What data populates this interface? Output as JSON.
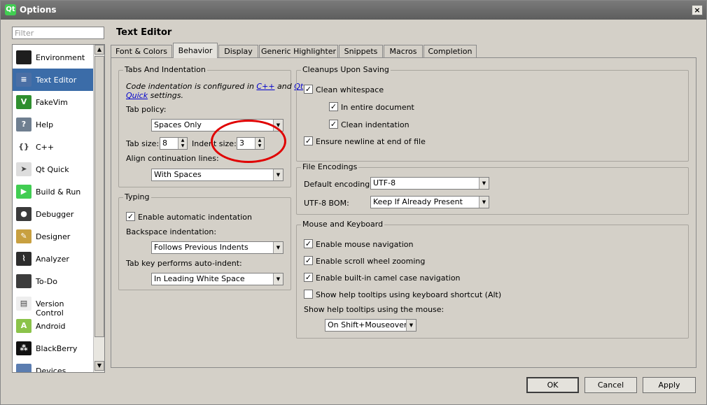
{
  "window": {
    "title": "Options",
    "app_icon": "qt-icon",
    "close_label": "×"
  },
  "filter": {
    "placeholder": "Filter"
  },
  "sidebar": {
    "items": [
      {
        "label": "Environment",
        "icon": "monitor-icon",
        "icon_color": "#1e1e1e",
        "glyph": ""
      },
      {
        "label": "Text Editor",
        "icon": "text-editor-icon",
        "icon_color": "#4a6fa5",
        "glyph": "≡",
        "selected": true
      },
      {
        "label": "FakeVim",
        "icon": "fakevim-icon",
        "icon_color": "#2f8f2f",
        "glyph": "V"
      },
      {
        "label": "Help",
        "icon": "help-icon",
        "icon_color": "#6f7f90",
        "glyph": "?"
      },
      {
        "label": "C++",
        "icon": "braces-icon",
        "icon_color": "#ffffff",
        "glyph": "{}"
      },
      {
        "label": "Qt Quick",
        "icon": "paper-plane-icon",
        "icon_color": "#dddddd",
        "glyph": "➤"
      },
      {
        "label": "Build & Run",
        "icon": "build-run-icon",
        "icon_color": "#41cd52",
        "glyph": "▶"
      },
      {
        "label": "Debugger",
        "icon": "bug-icon",
        "icon_color": "#3a3a3a",
        "glyph": "●"
      },
      {
        "label": "Designer",
        "icon": "pencil-icon",
        "icon_color": "#c8a040",
        "glyph": "✎"
      },
      {
        "label": "Analyzer",
        "icon": "analyzer-icon",
        "icon_color": "#2d2d2d",
        "glyph": "⌇"
      },
      {
        "label": "To-Do",
        "icon": "todo-icon",
        "icon_color": "#3c3c3c",
        "glyph": ""
      },
      {
        "label": "Version Control",
        "icon": "document-icon",
        "icon_color": "#eeeeee",
        "glyph": "▤"
      },
      {
        "label": "Android",
        "icon": "android-icon",
        "icon_color": "#8bc34a",
        "glyph": "A"
      },
      {
        "label": "BlackBerry",
        "icon": "blackberry-icon",
        "icon_color": "#111111",
        "glyph": "⁂"
      },
      {
        "label": "Devices",
        "icon": "devices-icon",
        "icon_color": "#5b7db0",
        "glyph": ""
      }
    ]
  },
  "page_title": "Text Editor",
  "tabs": [
    {
      "label": "Font & Colors"
    },
    {
      "label": "Behavior",
      "active": true
    },
    {
      "label": "Display"
    },
    {
      "label": "Generic Highlighter"
    },
    {
      "label": "Snippets"
    },
    {
      "label": "Macros"
    },
    {
      "label": "Completion"
    }
  ],
  "tabs_indent": {
    "title": "Tabs And Indentation",
    "note_prefix": "Code indentation is configured in ",
    "link_cpp": "C++",
    "note_and": " and ",
    "link_qt": "Qt",
    "link_quick": "Quick",
    "note_suffix": " settings.",
    "tab_policy_label": "Tab policy:",
    "tab_policy_value": "Spaces Only",
    "tab_size_label": "Tab size:",
    "tab_size_value": "8",
    "indent_size_label": "Indent size:",
    "indent_size_value": "3",
    "align_label": "Align continuation lines:",
    "align_value": "With Spaces"
  },
  "typing": {
    "title": "Typing",
    "auto_indent_label": "Enable automatic indentation",
    "backspace_label": "Backspace indentation:",
    "backspace_value": "Follows Previous Indents",
    "tabkey_label": "Tab key performs auto-indent:",
    "tabkey_value": "In Leading White Space"
  },
  "cleanups": {
    "title": "Cleanups Upon Saving",
    "clean_ws": "Clean whitespace",
    "entire_doc": "In entire document",
    "clean_indent": "Clean indentation",
    "ensure_newline": "Ensure newline at end of file"
  },
  "encodings": {
    "title": "File Encodings",
    "default_label": "Default encoding:",
    "default_value": "UTF-8",
    "bom_label": "UTF-8 BOM:",
    "bom_value": "Keep If Already Present"
  },
  "mouse_keyboard": {
    "title": "Mouse and Keyboard",
    "mouse_nav": "Enable mouse navigation",
    "scroll_zoom": "Enable scroll wheel zooming",
    "camel": "Enable built-in camel case navigation",
    "help_kbd": "Show help tooltips using keyboard shortcut (Alt)",
    "help_mouse_label": "Show help tooltips using the mouse:",
    "help_mouse_value": "On Shift+Mouseover"
  },
  "buttons": {
    "ok": "OK",
    "cancel": "Cancel",
    "apply": "Apply"
  },
  "checkmark": "✓",
  "colors": {
    "titlebar": "#666666",
    "selection": "#3b6ca8",
    "annotation": "#e00000",
    "link": "#0000cc"
  }
}
